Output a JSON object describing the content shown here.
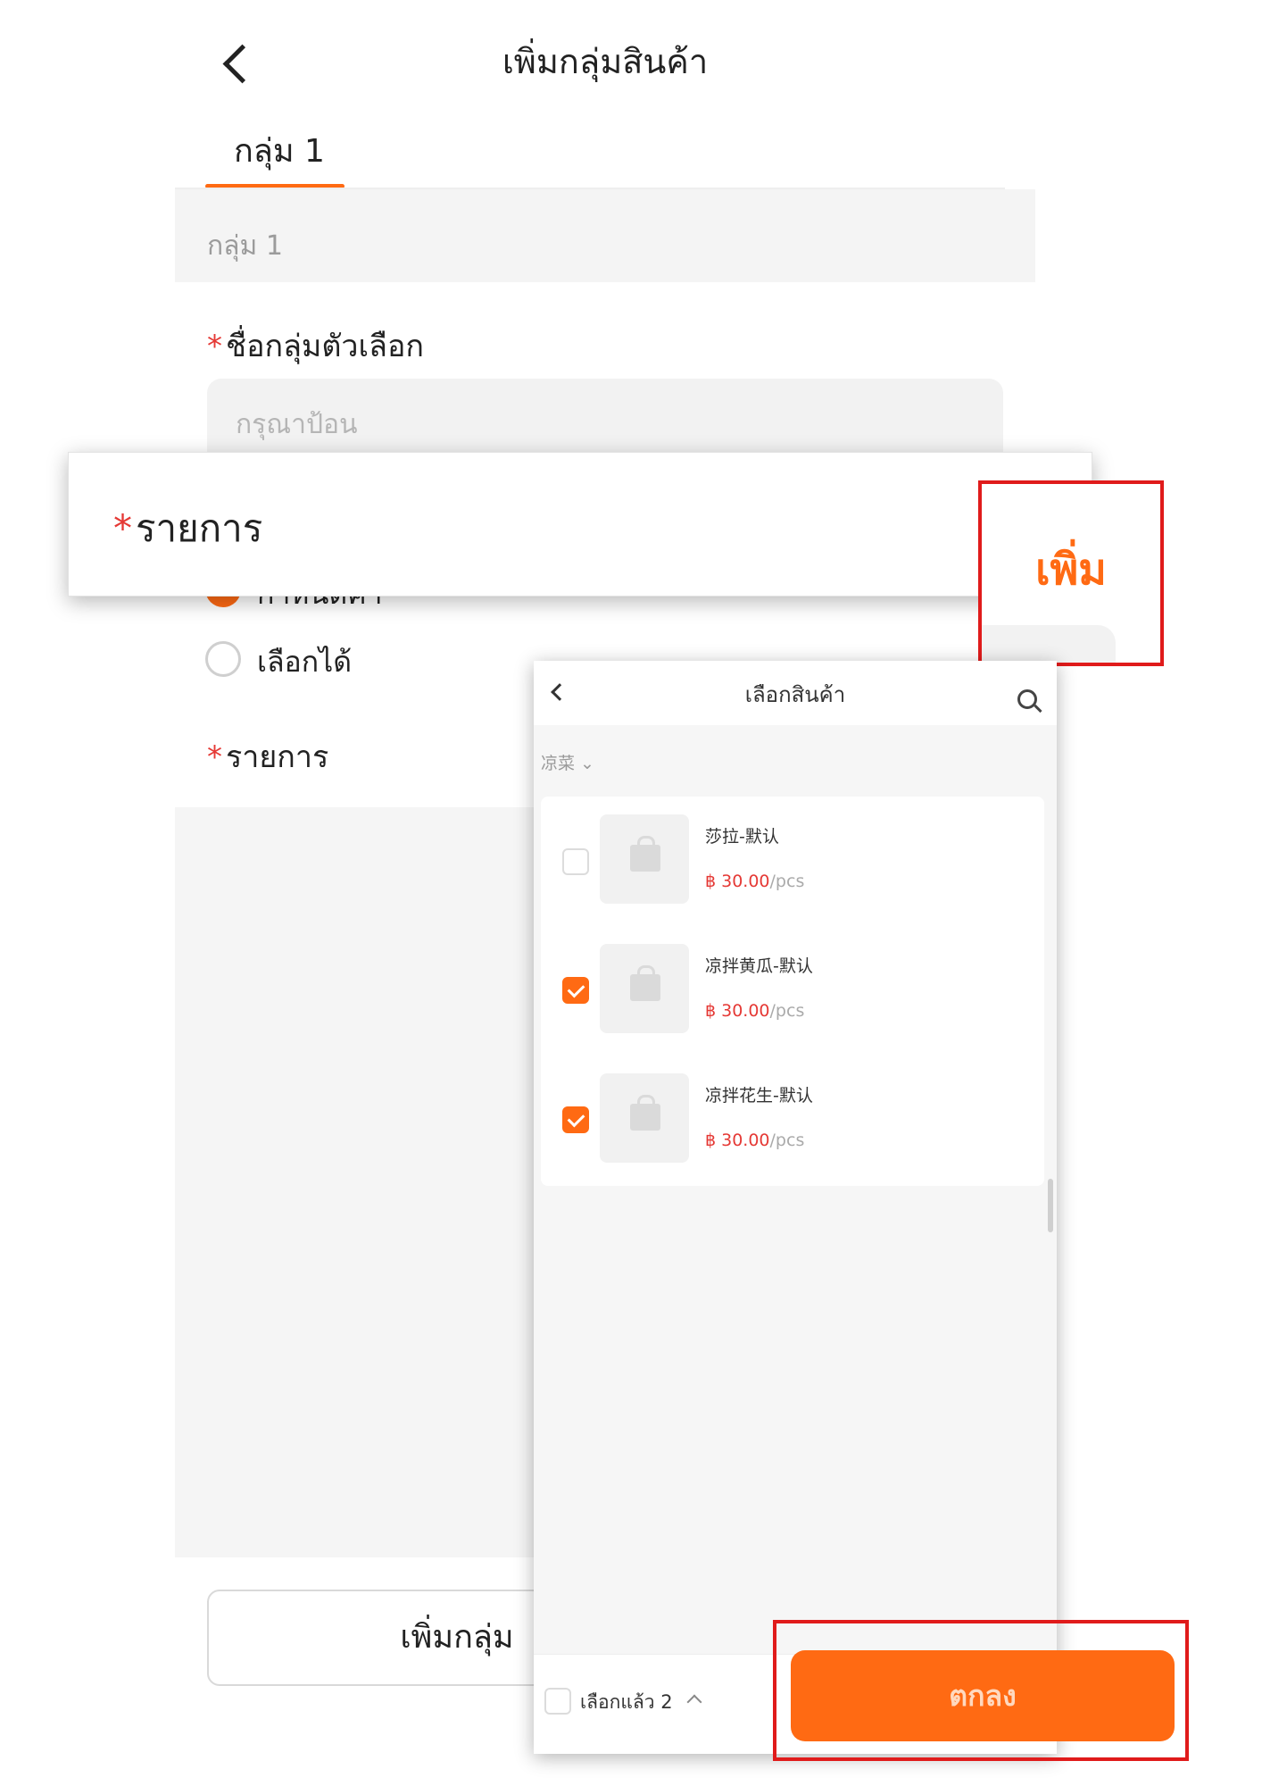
{
  "background_page": {
    "title": "เพิ่มกลุ่มสินค้า",
    "tab_label": "กลุ่ม 1",
    "group_strip_label": "กลุ่ม 1",
    "option_group_name_label": "ชื่อกลุ่มตัวเลือก",
    "option_group_name_placeholder": "กรุณาป้อน",
    "selection_mode": {
      "options": [
        "กำหนดค่า",
        "เลือกได้"
      ],
      "selected": "กำหนดค่า"
    },
    "items_label": "รายการ",
    "add_group_button": "เพิ่มกลุ่ม",
    "accent_color": "#ff6a13"
  },
  "zoom_callouts": {
    "items_label": "รายการ",
    "add_button": "เพิ่ม",
    "required_marker": "*"
  },
  "product_picker": {
    "title": "เลือกสินค้า",
    "category_filter": "凉菜 ⌄",
    "products": [
      {
        "name": "莎拉-默认",
        "price": "฿ 30.00",
        "unit": "/pcs",
        "checked": false
      },
      {
        "name": "凉拌黄瓜-默认",
        "price": "฿ 30.00",
        "unit": "/pcs",
        "checked": true
      },
      {
        "name": "凉拌花生-默认",
        "price": "฿ 30.00",
        "unit": "/pcs",
        "checked": true
      }
    ],
    "selected_count_label": "เลือกแล้ว 2",
    "confirm_button": "ตกลง"
  },
  "icons": [
    "back-chevron-icon",
    "search-icon",
    "bag-icon",
    "chevron-up-icon",
    "checkbox-icon"
  ]
}
